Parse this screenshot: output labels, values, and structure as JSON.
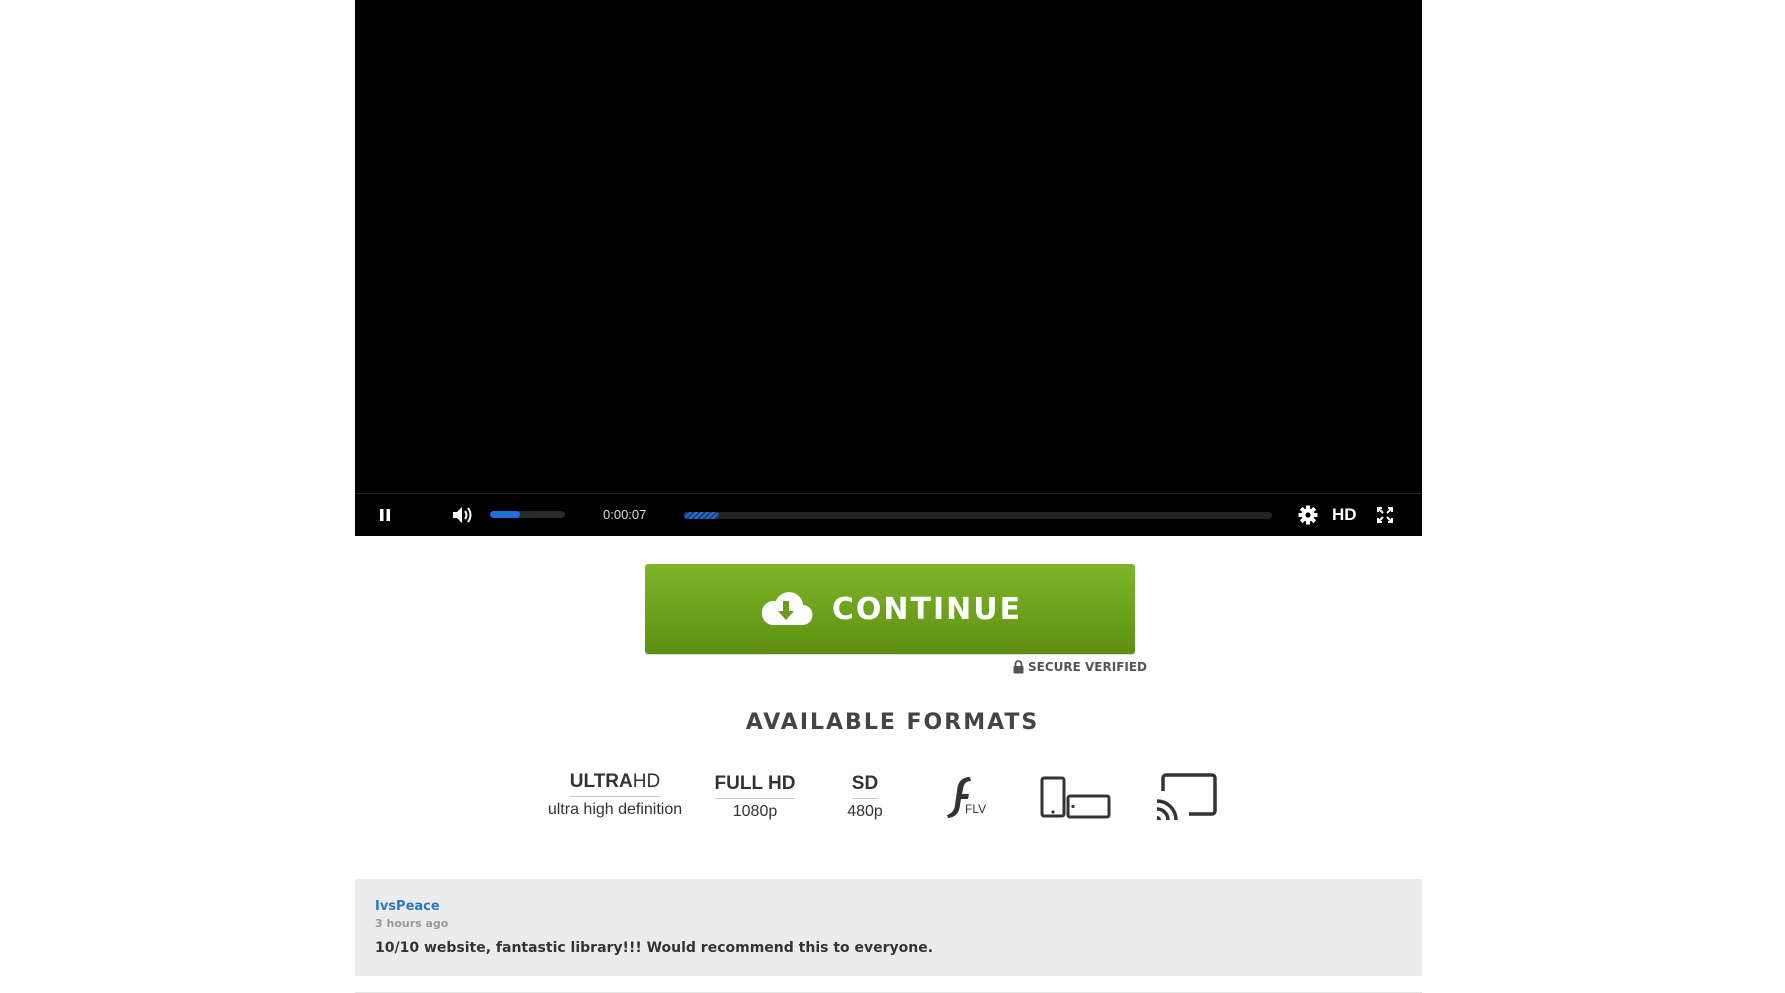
{
  "player": {
    "time": "0:00:07",
    "volume_fraction": 0.4,
    "buffered_fraction": 0.06,
    "quality_label": "HD",
    "icons": [
      "pause-icon",
      "volume-icon",
      "gear-icon",
      "fullscreen-icon"
    ]
  },
  "cta": {
    "label": "CONTINUE",
    "icon": "cloud-download-icon",
    "secure_label": "SECURE VERIFIED",
    "color": "#6fa31e"
  },
  "formats": {
    "title": "AVAILABLE FORMATS",
    "items": [
      {
        "bold": "ULTRA",
        "thin": "HD",
        "sub": "ultra high definition"
      },
      {
        "bold": "FULL HD",
        "sub": "1080p"
      },
      {
        "bold": "SD",
        "sub": "480p"
      },
      {
        "icon": "flash-flv-icon",
        "label": "FLV"
      },
      {
        "icon": "devices-icon"
      },
      {
        "icon": "cast-icon"
      }
    ]
  },
  "comment": {
    "author": "IvsPeace",
    "time": "3 hours ago",
    "text": "10/10 website, fantastic library!!! Would recommend this to everyone."
  }
}
